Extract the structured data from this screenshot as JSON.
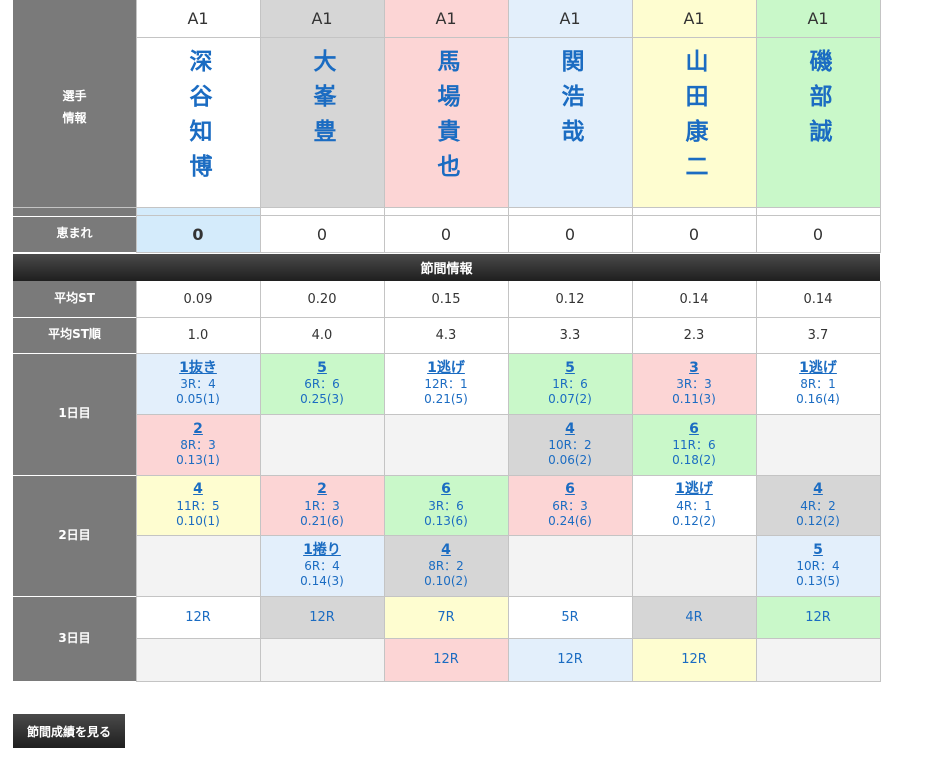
{
  "labels": {
    "player_info": [
      "選手",
      "情報"
    ],
    "megumare": "恵まれ",
    "banner": "節間情報",
    "avg_st": "平均ST",
    "avg_st_rank": "平均ST順",
    "days": [
      "1日目",
      "2日目",
      "3日目"
    ]
  },
  "players": [
    {
      "grade": "A1",
      "name": "深谷知博",
      "color": "#ffffff",
      "megumare": "0",
      "avg_st": "0.09",
      "avg_st_rank": "1.0"
    },
    {
      "grade": "A1",
      "name": "大峯豊",
      "color": "#d6d6d6",
      "megumare": "0",
      "avg_st": "0.20",
      "avg_st_rank": "4.0"
    },
    {
      "grade": "A1",
      "name": "馬場貴也",
      "color": "#fcd5d5",
      "megumare": "0",
      "avg_st": "0.15",
      "avg_st_rank": "4.3"
    },
    {
      "grade": "A1",
      "name": "関浩哉",
      "color": "#e3effb",
      "megumare": "0",
      "avg_st": "0.12",
      "avg_st_rank": "3.3"
    },
    {
      "grade": "A1",
      "name": "山田康二",
      "color": "#fefdd0",
      "megumare": "0",
      "avg_st": "0.14",
      "avg_st_rank": "2.3"
    },
    {
      "grade": "A1",
      "name": "磯部誠",
      "color": "#c9f8c9",
      "megumare": "0",
      "avg_st": "0.14",
      "avg_st_rank": "3.7"
    }
  ],
  "colors": {
    "white": "#ffffff",
    "gray": "#d6d6d6",
    "red": "#fcd5d5",
    "blue": "#e3effb",
    "yellow": "#fefdd0",
    "green": "#c9f8c9",
    "empty": "#f3f3f3",
    "megumare_hl": "#d4ebfb"
  },
  "results": [
    [
      [
        {
          "res": "1抜き",
          "race": "3R：4",
          "st": "0.05(1)",
          "bg": "blue"
        },
        {
          "res": "2",
          "race": "8R：3",
          "st": "0.13(1)",
          "bg": "red"
        }
      ],
      [
        {
          "res": "5",
          "race": "6R：6",
          "st": "0.25(3)",
          "bg": "green"
        },
        null
      ],
      [
        {
          "res": "1逃げ",
          "race": "12R：1",
          "st": "0.21(5)",
          "bg": "white"
        },
        null
      ],
      [
        {
          "res": "5",
          "race": "1R：6",
          "st": "0.07(2)",
          "bg": "green"
        },
        {
          "res": "4",
          "race": "10R：2",
          "st": "0.06(2)",
          "bg": "gray"
        }
      ],
      [
        {
          "res": "3",
          "race": "3R：3",
          "st": "0.11(3)",
          "bg": "red"
        },
        {
          "res": "6",
          "race": "11R：6",
          "st": "0.18(2)",
          "bg": "green"
        }
      ],
      [
        {
          "res": "1逃げ",
          "race": "8R：1",
          "st": "0.16(4)",
          "bg": "white"
        },
        null
      ]
    ],
    [
      [
        {
          "res": "4",
          "race": "11R：5",
          "st": "0.10(1)",
          "bg": "yellow"
        },
        null
      ],
      [
        {
          "res": "2",
          "race": "1R：3",
          "st": "0.21(6)",
          "bg": "red"
        },
        {
          "res": "1捲り",
          "race": "6R：4",
          "st": "0.14(3)",
          "bg": "blue"
        }
      ],
      [
        {
          "res": "6",
          "race": "3R：6",
          "st": "0.13(6)",
          "bg": "green"
        },
        {
          "res": "4",
          "race": "8R：2",
          "st": "0.10(2)",
          "bg": "gray"
        }
      ],
      [
        {
          "res": "6",
          "race": "6R：3",
          "st": "0.24(6)",
          "bg": "red"
        },
        null
      ],
      [
        {
          "res": "1逃げ",
          "race": "4R：1",
          "st": "0.12(2)",
          "bg": "white"
        },
        null
      ],
      [
        {
          "res": "4",
          "race": "4R：2",
          "st": "0.12(2)",
          "bg": "gray"
        },
        {
          "res": "5",
          "race": "10R：4",
          "st": "0.13(5)",
          "bg": "blue"
        }
      ]
    ]
  ],
  "day3": [
    [
      {
        "race": "12R",
        "bg": "white"
      },
      null
    ],
    [
      {
        "race": "12R",
        "bg": "gray"
      },
      null
    ],
    [
      {
        "race": "7R",
        "bg": "yellow"
      },
      {
        "race": "12R",
        "bg": "red"
      }
    ],
    [
      {
        "race": "5R",
        "bg": "white"
      },
      {
        "race": "12R",
        "bg": "blue"
      }
    ],
    [
      {
        "race": "4R",
        "bg": "gray"
      },
      {
        "race": "12R",
        "bg": "yellow"
      }
    ],
    [
      {
        "race": "12R",
        "bg": "green"
      },
      null
    ]
  ],
  "button_label": "節間成績を見る"
}
